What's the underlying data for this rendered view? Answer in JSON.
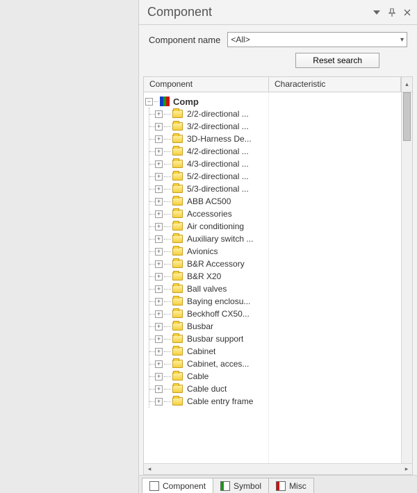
{
  "panel": {
    "title": "Component"
  },
  "search": {
    "label": "Component name",
    "combo_value": "<All>",
    "reset_label": "Reset search"
  },
  "columns": {
    "component": "Component",
    "characteristic": "Characteristic"
  },
  "tree": {
    "root_label": "Comp",
    "children": [
      {
        "label": "2/2-directional ..."
      },
      {
        "label": "3/2-directional ..."
      },
      {
        "label": "3D-Harness De..."
      },
      {
        "label": "4/2-directional ..."
      },
      {
        "label": "4/3-directional ..."
      },
      {
        "label": "5/2-directional ..."
      },
      {
        "label": "5/3-directional ..."
      },
      {
        "label": "ABB AC500"
      },
      {
        "label": "Accessories"
      },
      {
        "label": "Air conditioning"
      },
      {
        "label": "Auxiliary switch ..."
      },
      {
        "label": "Avionics"
      },
      {
        "label": "B&R Accessory"
      },
      {
        "label": "B&R X20"
      },
      {
        "label": "Ball valves"
      },
      {
        "label": "Baying enclosu..."
      },
      {
        "label": "Beckhoff CX50..."
      },
      {
        "label": "Busbar"
      },
      {
        "label": "Busbar support"
      },
      {
        "label": "Cabinet"
      },
      {
        "label": "Cabinet, acces..."
      },
      {
        "label": "Cable"
      },
      {
        "label": "Cable duct"
      },
      {
        "label": "Cable entry frame"
      }
    ]
  },
  "tabs": {
    "component": "Component",
    "symbol": "Symbol",
    "misc": "Misc"
  },
  "tab_colors": {
    "component": [
      "#ffffff",
      "#ffffff",
      "#ffffff"
    ],
    "symbol": [
      "#1a9a1a",
      "#ffffff",
      "#ffffff"
    ],
    "misc": [
      "#d01010",
      "#ffffff",
      "#ffffff"
    ]
  }
}
